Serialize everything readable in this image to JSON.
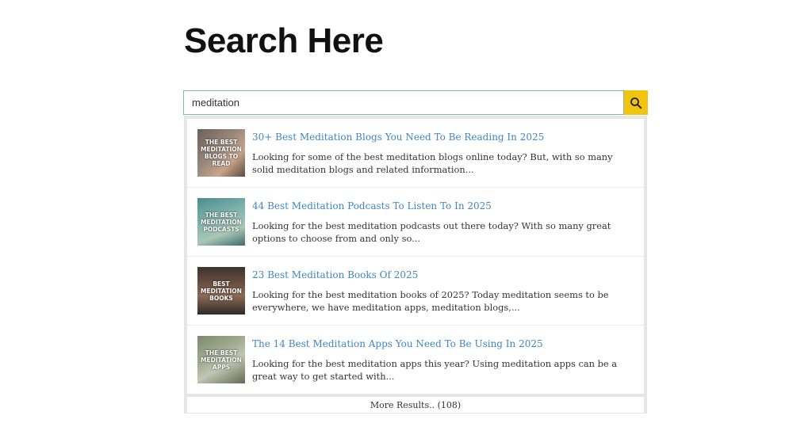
{
  "page": {
    "title": "Search Here"
  },
  "search": {
    "value": "meditation",
    "button_icon": "search-icon",
    "button_color": "#f1c40f"
  },
  "results": [
    {
      "thumb_caption": "THE BEST MEDITATION BLOGS TO READ",
      "title": "30+ Best Meditation Blogs You Need To Be Reading In 2025",
      "excerpt": "Looking for some of the best meditation blogs online today? But, with so many solid meditation blogs and related information..."
    },
    {
      "thumb_caption": "THE BEST MEDITATION PODCASTS",
      "title": "44 Best Meditation Podcasts To Listen To In 2025",
      "excerpt": "Looking for the best meditation podcasts out there today? With so many great options to choose from and only so..."
    },
    {
      "thumb_caption": "BEST MEDITATION BOOKS",
      "title": "23 Best Meditation Books Of 2025",
      "excerpt": "Looking for the best meditation books of 2025? Today meditation seems to be everywhere, we have meditation apps, meditation blogs,..."
    },
    {
      "thumb_caption": "THE BEST MEDITATION APPS",
      "title": "The 14 Best Meditation Apps You Need To Be Using In 2025",
      "excerpt": "Looking for the best meditation apps this year? Using meditation apps can be a great way to get started with..."
    }
  ],
  "more_results": {
    "label": "More Results.. (108)"
  },
  "colors": {
    "link": "#3f86c4",
    "input_border": "#7fb9b3",
    "panel_bg": "#e6e6e6"
  }
}
